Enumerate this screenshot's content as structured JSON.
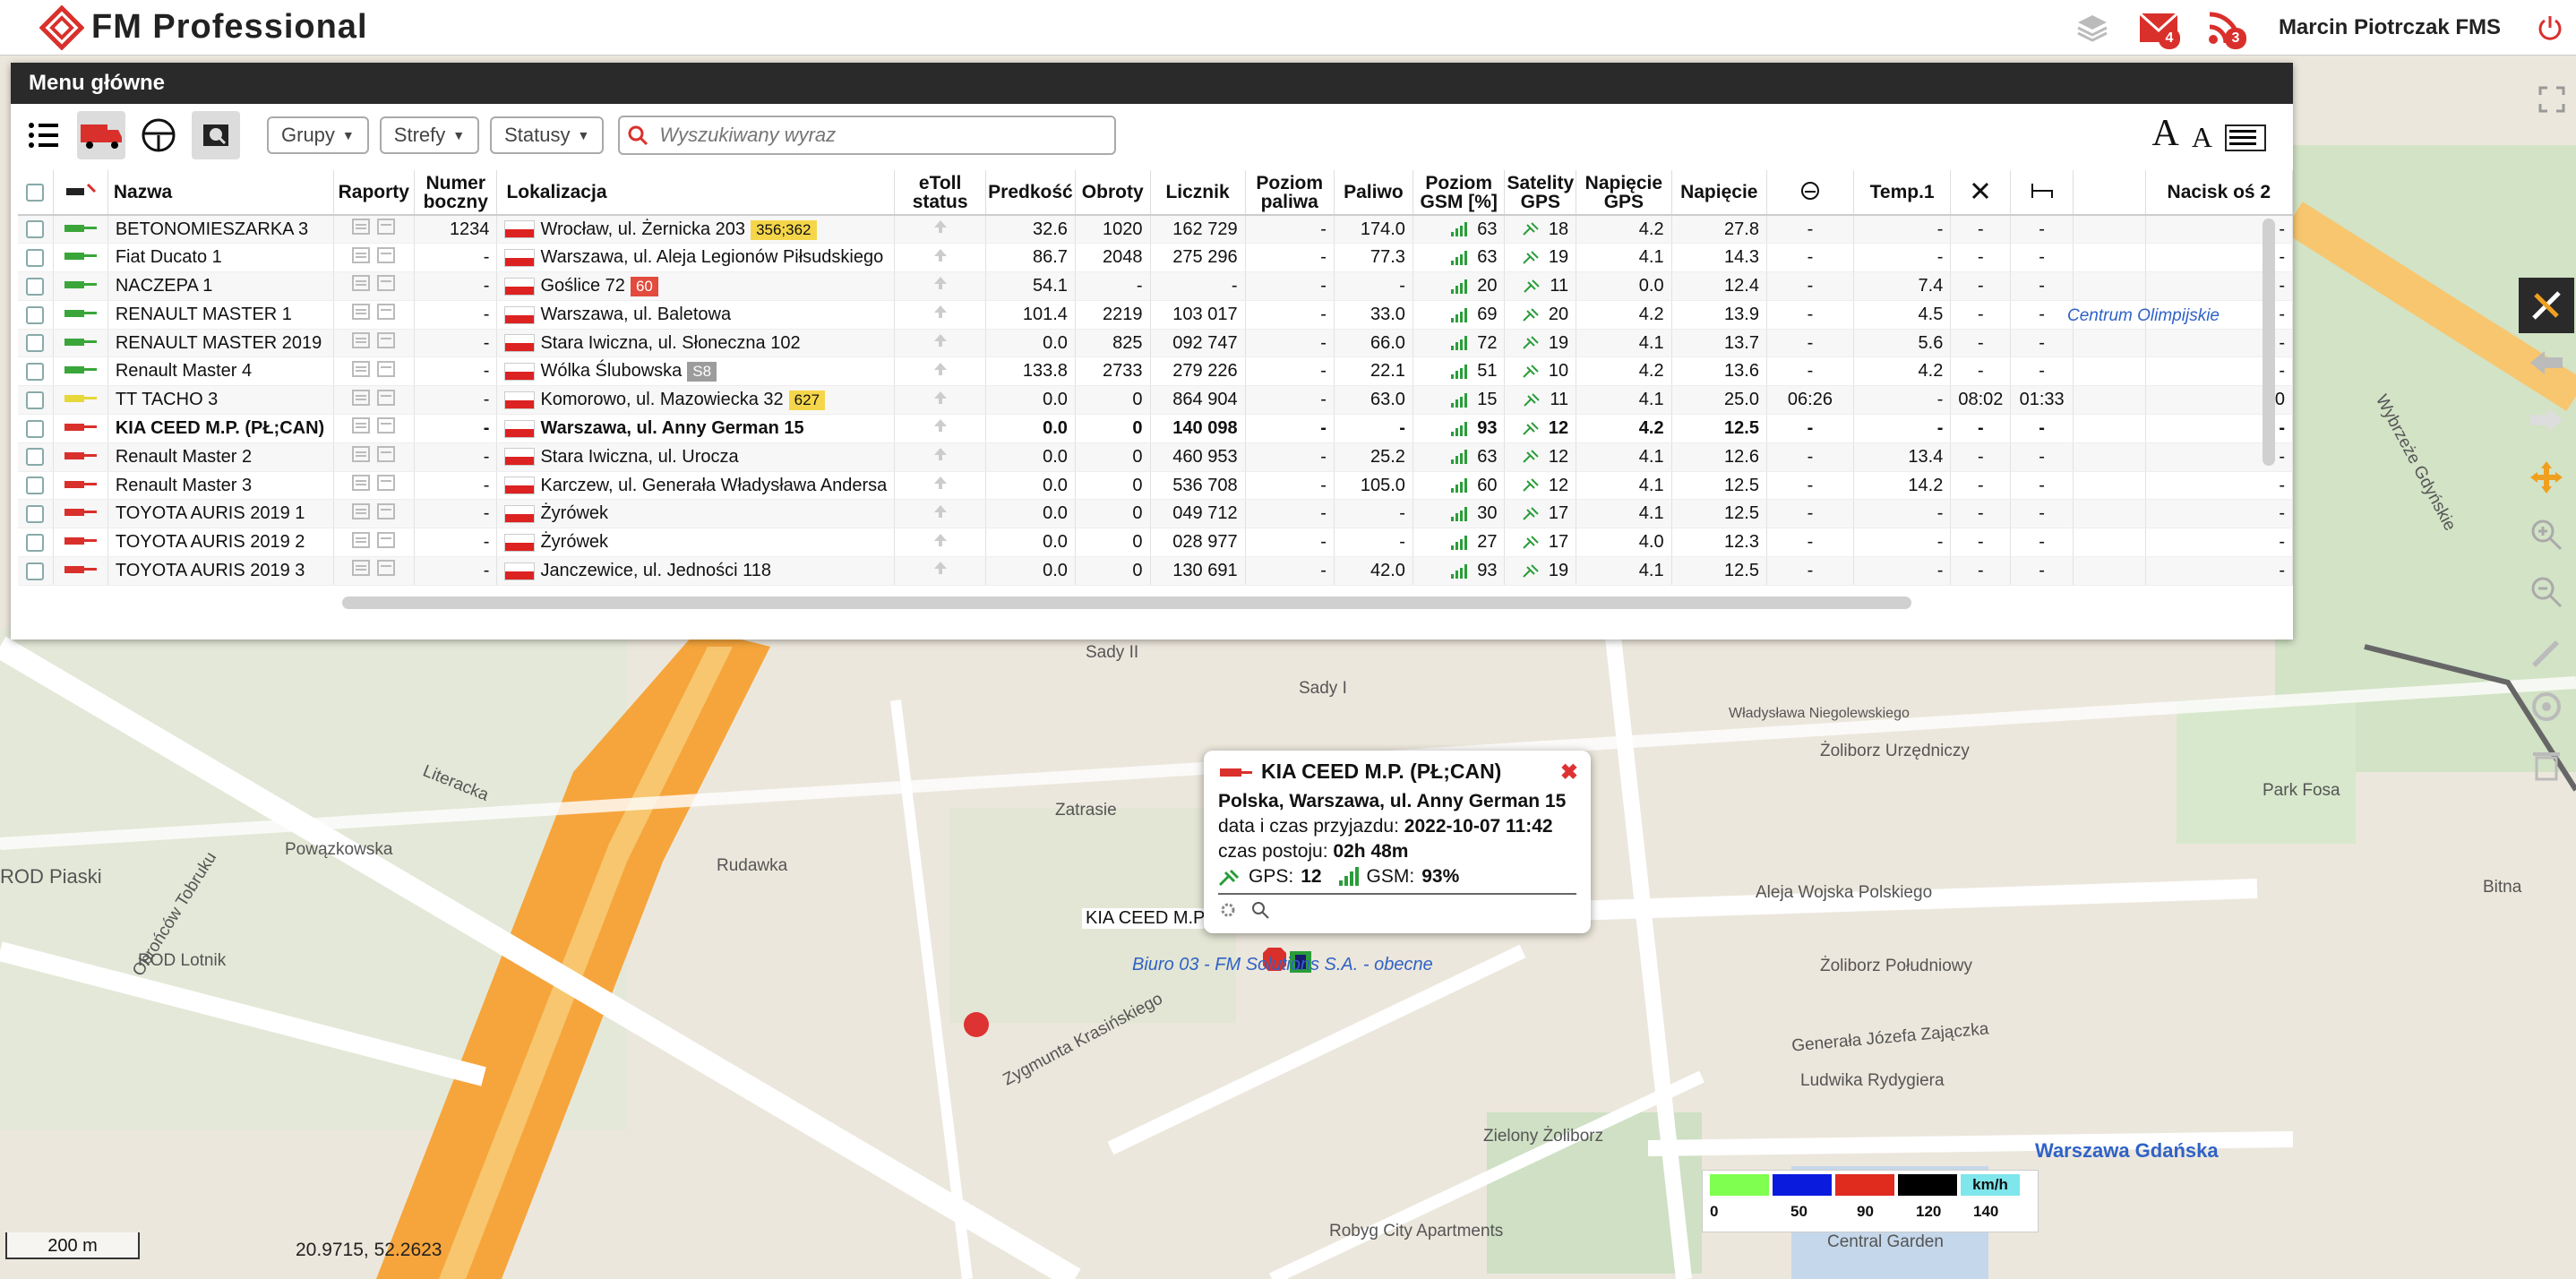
{
  "app": {
    "title": "FM Professional",
    "user": "Marcin Piotrczak FMS",
    "mail_count": "4",
    "rss_count": "3"
  },
  "panel": {
    "title": "Menu główne"
  },
  "toolbar": {
    "groups": "Grupy",
    "zones": "Strefy",
    "statuses": "Statusy",
    "search_placeholder": "Wyszukiwany wyraz",
    "font_big": "A",
    "font_small": "A"
  },
  "columns": [
    "Nazwa",
    "Raporty",
    "Numer boczny",
    "Lokalizacja",
    "eToll status",
    "Predkość",
    "Obroty",
    "Licznik",
    "Poziom paliwa",
    "Paliwo",
    "Poziom GSM [%]",
    "Satelity GPS",
    "Napięcie GPS",
    "Napięcie",
    "Temp.1",
    "Nacisk oś 2"
  ],
  "rows": [
    {
      "status": "green",
      "name": "BETONOMIESZARKA 3",
      "side": "1234",
      "loc": "Wrocław, ul. Żernicka 203",
      "tag": "356;362",
      "tagc": "y",
      "speed": "32.6",
      "rpm": "1020",
      "odo": "162 729",
      "flevel": "-",
      "fuel": "174.0",
      "gsm": "63",
      "sat": "18",
      "vgps": "4.2",
      "volt": "27.8",
      "c1": "-",
      "temp": "-",
      "c2": "-",
      "c3": "-",
      "axle": "-",
      "bold": false
    },
    {
      "status": "green",
      "name": "Fiat Ducato 1",
      "side": "-",
      "loc": "Warszawa, ul. Aleja Legionów Piłsudskiego",
      "tag": "",
      "tagc": "",
      "speed": "86.7",
      "rpm": "2048",
      "odo": "275 296",
      "flevel": "-",
      "fuel": "77.3",
      "gsm": "63",
      "sat": "19",
      "vgps": "4.1",
      "volt": "14.3",
      "c1": "-",
      "temp": "-",
      "c2": "-",
      "c3": "-",
      "axle": "-",
      "bold": false
    },
    {
      "status": "green",
      "name": "NACZEPA 1",
      "side": "-",
      "loc": "Goślice 72",
      "tag": "60",
      "tagc": "r",
      "speed": "54.1",
      "rpm": "-",
      "odo": "-",
      "flevel": "-",
      "fuel": "-",
      "gsm": "20",
      "sat": "11",
      "vgps": "0.0",
      "volt": "12.4",
      "c1": "-",
      "temp": "7.4",
      "c2": "-",
      "c3": "-",
      "axle": "-",
      "bold": false
    },
    {
      "status": "green",
      "name": "RENAULT MASTER 1",
      "side": "-",
      "loc": "Warszawa, ul. Baletowa",
      "tag": "",
      "tagc": "",
      "speed": "101.4",
      "rpm": "2219",
      "odo": "103 017",
      "flevel": "-",
      "fuel": "33.0",
      "gsm": "69",
      "sat": "20",
      "vgps": "4.2",
      "volt": "13.9",
      "c1": "-",
      "temp": "4.5",
      "c2": "-",
      "c3": "-",
      "axle": "-",
      "bold": false
    },
    {
      "status": "green",
      "name": "RENAULT MASTER 2019",
      "side": "-",
      "loc": "Stara Iwiczna, ul. Słoneczna 102",
      "tag": "",
      "tagc": "",
      "speed": "0.0",
      "rpm": "825",
      "odo": "092 747",
      "flevel": "-",
      "fuel": "66.0",
      "gsm": "72",
      "sat": "19",
      "vgps": "4.1",
      "volt": "13.7",
      "c1": "-",
      "temp": "5.6",
      "c2": "-",
      "c3": "-",
      "axle": "-",
      "bold": false
    },
    {
      "status": "green",
      "name": "Renault Master 4",
      "side": "-",
      "loc": "Wólka Ślubowska",
      "tag": "S8",
      "tagc": "g",
      "speed": "133.8",
      "rpm": "2733",
      "odo": "279 226",
      "flevel": "-",
      "fuel": "22.1",
      "gsm": "51",
      "sat": "10",
      "vgps": "4.2",
      "volt": "13.6",
      "c1": "-",
      "temp": "4.2",
      "c2": "-",
      "c3": "-",
      "axle": "-",
      "bold": false
    },
    {
      "status": "yellow",
      "name": "TT TACHO 3",
      "side": "-",
      "loc": "Komorowo, ul. Mazowiecka 32",
      "tag": "627",
      "tagc": "y",
      "speed": "0.0",
      "rpm": "0",
      "odo": "864 904",
      "flevel": "-",
      "fuel": "63.0",
      "gsm": "15",
      "sat": "11",
      "vgps": "4.1",
      "volt": "25.0",
      "c1": "06:26",
      "temp": "-",
      "c2": "08:02",
      "c3": "01:33",
      "axle": "0",
      "bold": false
    },
    {
      "status": "red",
      "name": "KIA CEED M.P. (PŁ;CAN)",
      "side": "-",
      "loc": "Warszawa, ul. Anny German 15",
      "tag": "",
      "tagc": "",
      "speed": "0.0",
      "rpm": "0",
      "odo": "140 098",
      "flevel": "-",
      "fuel": "-",
      "gsm": "93",
      "sat": "12",
      "vgps": "4.2",
      "volt": "12.5",
      "c1": "-",
      "temp": "-",
      "c2": "-",
      "c3": "-",
      "axle": "-",
      "bold": true
    },
    {
      "status": "red",
      "name": "Renault Master 2",
      "side": "-",
      "loc": "Stara Iwiczna, ul. Urocza",
      "tag": "",
      "tagc": "",
      "speed": "0.0",
      "rpm": "0",
      "odo": "460 953",
      "flevel": "-",
      "fuel": "25.2",
      "gsm": "63",
      "sat": "12",
      "vgps": "4.1",
      "volt": "12.6",
      "c1": "-",
      "temp": "13.4",
      "c2": "-",
      "c3": "-",
      "axle": "-",
      "bold": false
    },
    {
      "status": "red",
      "name": "Renault Master 3",
      "side": "-",
      "loc": "Karczew, ul. Generała Władysława Andersa",
      "tag": "",
      "tagc": "",
      "speed": "0.0",
      "rpm": "0",
      "odo": "536 708",
      "flevel": "-",
      "fuel": "105.0",
      "gsm": "60",
      "sat": "12",
      "vgps": "4.1",
      "volt": "12.5",
      "c1": "-",
      "temp": "14.2",
      "c2": "-",
      "c3": "-",
      "axle": "-",
      "bold": false
    },
    {
      "status": "red",
      "name": "TOYOTA AURIS 2019 1",
      "side": "-",
      "loc": "Żyrówek",
      "tag": "",
      "tagc": "",
      "speed": "0.0",
      "rpm": "0",
      "odo": "049 712",
      "flevel": "-",
      "fuel": "-",
      "gsm": "30",
      "sat": "17",
      "vgps": "4.1",
      "volt": "12.5",
      "c1": "-",
      "temp": "-",
      "c2": "-",
      "c3": "-",
      "axle": "-",
      "bold": false
    },
    {
      "status": "red",
      "name": "TOYOTA AURIS 2019 2",
      "side": "-",
      "loc": "Żyrówek",
      "tag": "",
      "tagc": "",
      "speed": "0.0",
      "rpm": "0",
      "odo": "028 977",
      "flevel": "-",
      "fuel": "-",
      "gsm": "27",
      "sat": "17",
      "vgps": "4.0",
      "volt": "12.3",
      "c1": "-",
      "temp": "-",
      "c2": "-",
      "c3": "-",
      "axle": "-",
      "bold": false
    },
    {
      "status": "red",
      "name": "TOYOTA AURIS 2019 3",
      "side": "-",
      "loc": "Janczewice, ul. Jedności 118",
      "tag": "",
      "tagc": "",
      "speed": "0.0",
      "rpm": "0",
      "odo": "130 691",
      "flevel": "-",
      "fuel": "42.0",
      "gsm": "93",
      "sat": "19",
      "vgps": "4.1",
      "volt": "12.5",
      "c1": "-",
      "temp": "-",
      "c2": "-",
      "c3": "-",
      "axle": "-",
      "bold": false
    }
  ],
  "popup": {
    "title": "KIA CEED M.P. (PŁ;CAN)",
    "address": "Polska, Warszawa, ul. Anny German 15",
    "arrival_label": "data i czas przyjazdu:",
    "arrival": "2022-10-07 11:42",
    "stop_label": "czas postoju:",
    "stop": "02h 48m",
    "gps_label": "GPS:",
    "gps": "12",
    "gsm_label": "GSM:",
    "gsm": "93%"
  },
  "map": {
    "vehicle_label": "KIA CEED M.P.",
    "office_label": "Biuro 03 - FM Solutions S.A. - obecne",
    "scale": "200 m",
    "coords": "20.9715, 52.2623",
    "places": [
      "Sady II",
      "Sady I",
      "Zatrasie",
      "Rudawka",
      "ROD Piaski",
      "ROD Lotnik",
      "Powązkowska",
      "Centrum Olimpijskie",
      "Żoliborz Urzędniczy",
      "Żoliborz Południowy",
      "Park Fosa",
      "Warszawa Gdańska",
      "Robyg City Apartments",
      "Zielony Żoliborz",
      "Central Garden",
      "Aleja Wojska Polskiego",
      "Ludwika Rydygiera",
      "Zygmunta Krasińskiego",
      "Wybrzeże Gdyńskie",
      "Władysława Niegolewskiego",
      "Generała Józefa Zajączka",
      "Bitna",
      "Obrońców Tobruku",
      "Literacka"
    ]
  },
  "legend": {
    "unit": "km/h",
    "values": [
      "0",
      "50",
      "90",
      "120",
      "140"
    ],
    "colors": [
      "#7fff4f",
      "#0a1bde",
      "#e02b1f",
      "#000000",
      "#7fe6ec"
    ]
  }
}
